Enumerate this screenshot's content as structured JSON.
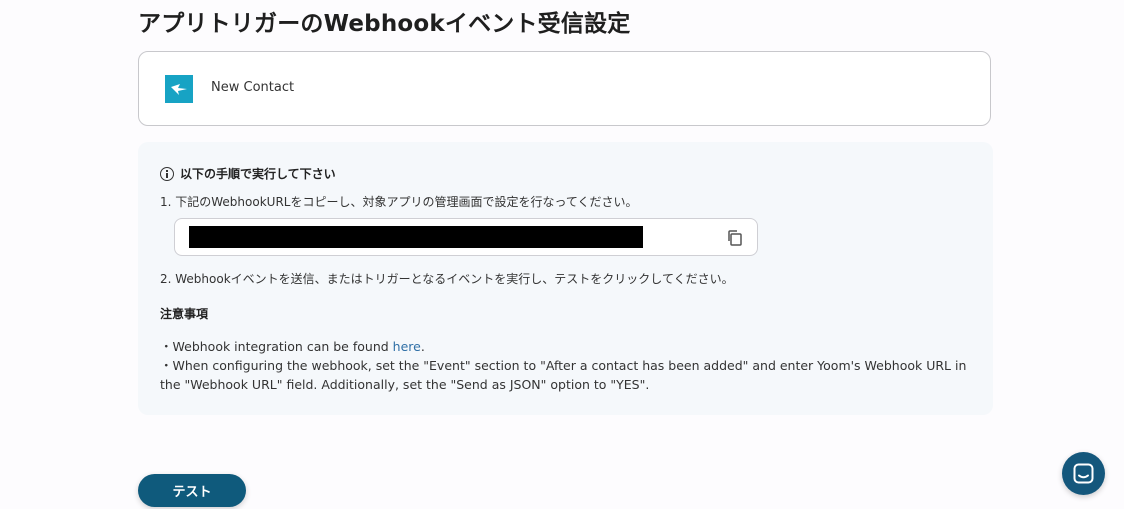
{
  "page": {
    "title": "アプリトリガーのWebhookイベント受信設定"
  },
  "app_card": {
    "logo_icon": "hubspot-like-app-logo-icon",
    "trigger_name": "New Contact"
  },
  "instructions": {
    "heading": "以下の手順で実行して下さい",
    "step1": "1. 下記のWebhookURLをコピーし、対象アプリの管理画面で設定を行なってください。",
    "webhook_url_redacted": true,
    "copy_icon": "copy-icon",
    "step2": "2. Webhookイベントを送信、またはトリガーとなるイベントを実行し、テストをクリックしてください。"
  },
  "notes": {
    "title": "注意事項",
    "note1_prefix": "・Webhook integration can be found ",
    "note1_link": "here",
    "note1_suffix": ".",
    "note2": "・When configuring the webhook, set the \"Event\" section to \"After a contact has been added\" and enter Yoom's Webhook URL in the \"Webhook URL\" field. Additionally, set the \"Send as JSON\" option to \"YES\"."
  },
  "actions": {
    "test_label": "テスト"
  },
  "chat": {
    "icon": "chat-icon"
  },
  "colors": {
    "primary": "#0f5a7c",
    "link": "#2f6fa6",
    "panel_bg": "#f5f8fb",
    "logo": "#17a3c4"
  }
}
